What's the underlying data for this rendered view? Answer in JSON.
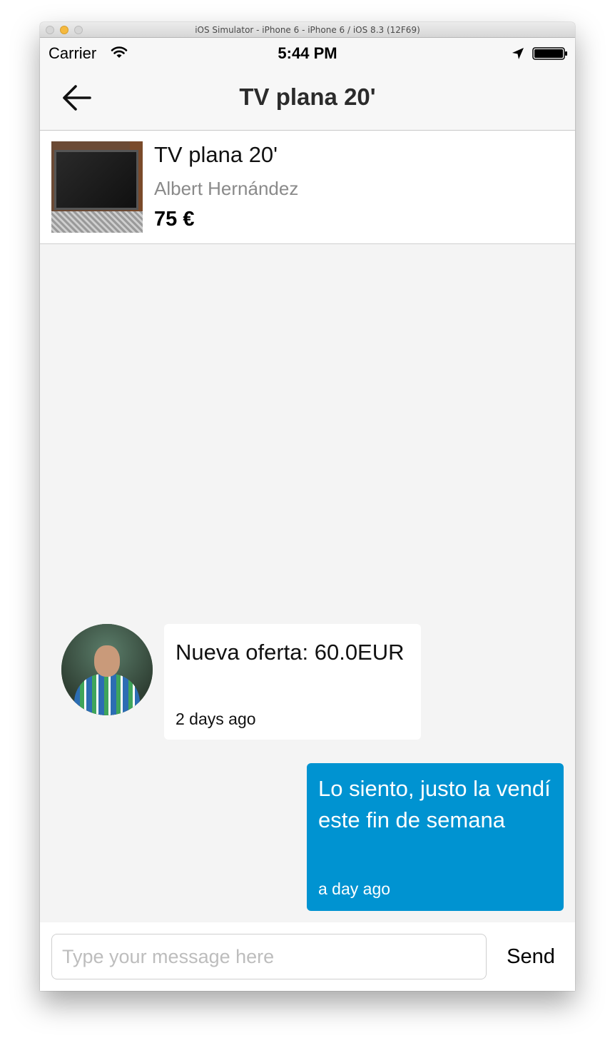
{
  "window": {
    "title": "iOS Simulator - iPhone 6 - iPhone 6 / iOS 8.3 (12F69)"
  },
  "status_bar": {
    "carrier": "Carrier",
    "time": "5:44 PM",
    "icons": [
      "wifi-icon",
      "location-arrow-icon",
      "battery-icon"
    ]
  },
  "nav": {
    "title": "TV plana 20'",
    "back_icon": "arrow-left-icon"
  },
  "product": {
    "title": "TV plana 20'",
    "seller": "Albert Hernández",
    "price": "75 €"
  },
  "messages": [
    {
      "direction": "incoming",
      "text": "Nueva oferta: 60.0EUR",
      "time": "2 days ago"
    },
    {
      "direction": "outgoing",
      "text": "Lo siento, justo la vendí este fin de semana",
      "time": "a day ago"
    }
  ],
  "composer": {
    "placeholder": "Type your message here",
    "value": "",
    "send_label": "Send"
  },
  "colors": {
    "outgoing_bubble": "#0093d1",
    "background": "#f4f4f4"
  }
}
